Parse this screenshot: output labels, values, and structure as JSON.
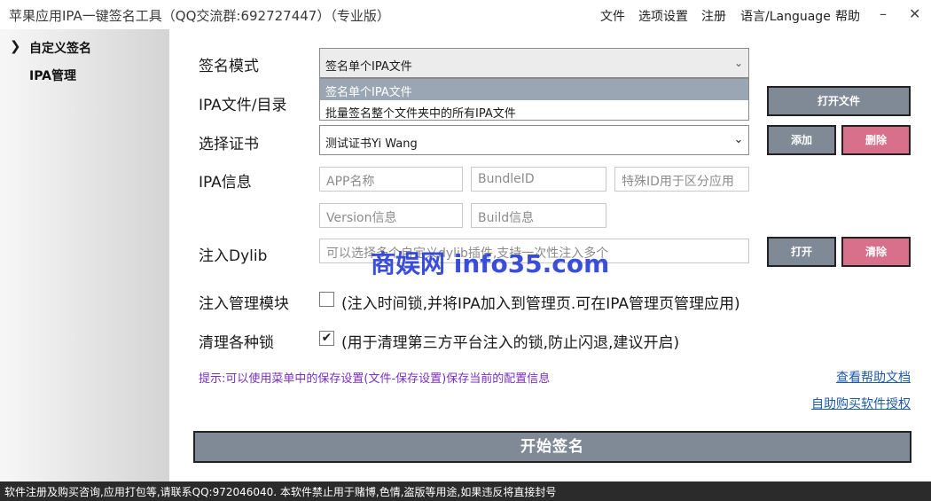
{
  "window": {
    "title": "苹果应用IPA一键签名工具（QQ交流群:692727447）（专业版）",
    "menu": [
      "文件",
      "选项设置",
      "注册",
      "语言/Language",
      "帮助"
    ],
    "minimize": "–",
    "close": "✕"
  },
  "sidebar": {
    "arrow": "❯",
    "items": [
      {
        "label": "自定义签名"
      },
      {
        "label": "IPA管理"
      }
    ]
  },
  "form": {
    "sign_mode": {
      "label": "签名模式",
      "value": "签名单个IPA文件",
      "options": [
        "签名单个IPA文件",
        "批量签名整个文件夹中的所有IPA文件"
      ]
    },
    "ipa_file": {
      "label": "IPA文件/目录",
      "button": "打开文件"
    },
    "certificate": {
      "label": "选择证书",
      "value": "测试证书Yi Wang",
      "add_button": "添加",
      "delete_button": "删除"
    },
    "ipa_info": {
      "label": "IPA信息",
      "app_name_placeholder": "APP名称",
      "bundle_id_placeholder": "BundleID",
      "special_id_placeholder": "特殊ID用于区分应用",
      "version_placeholder": "Version信息",
      "build_placeholder": "Build信息"
    },
    "dylib": {
      "label": "注入Dylib",
      "placeholder": "可以选择多个自定义dylib插件,支持一次性注入多个",
      "open_button": "打开",
      "clear_button": "清除"
    },
    "manage_module": {
      "label": "注入管理模块",
      "checked": false,
      "check_mark": "",
      "description": "(注入时间锁,并将IPA加入到管理页.可在IPA管理页管理应用)"
    },
    "clear_locks": {
      "label": "清理各种锁",
      "checked": true,
      "check_mark": "✔",
      "description": "(用于清理第三方平台注入的锁,防止闪退,建议开启)"
    }
  },
  "hint": "提示:可以使用菜单中的保存设置(文件-保存设置)保存当前的配置信息",
  "links": {
    "help_doc": "查看帮助文档",
    "buy_license": "自助购买软件授权"
  },
  "start_button": "开始签名",
  "status_bar": "软件注册及购买咨询,应用打包等,请联系QQ:972046040.  本软件禁止用于赌博,色情,盗版等用途,如果违反将直接封号",
  "watermark": "商娱网 info35.com",
  "colors": {
    "button_gray": "#7f8a96",
    "button_pink": "#d9708b",
    "selected_option": "#9ba6b4",
    "hint_text": "#7a2fbf",
    "link": "#1f5aa8",
    "status_bar": "#2b2b2b"
  }
}
